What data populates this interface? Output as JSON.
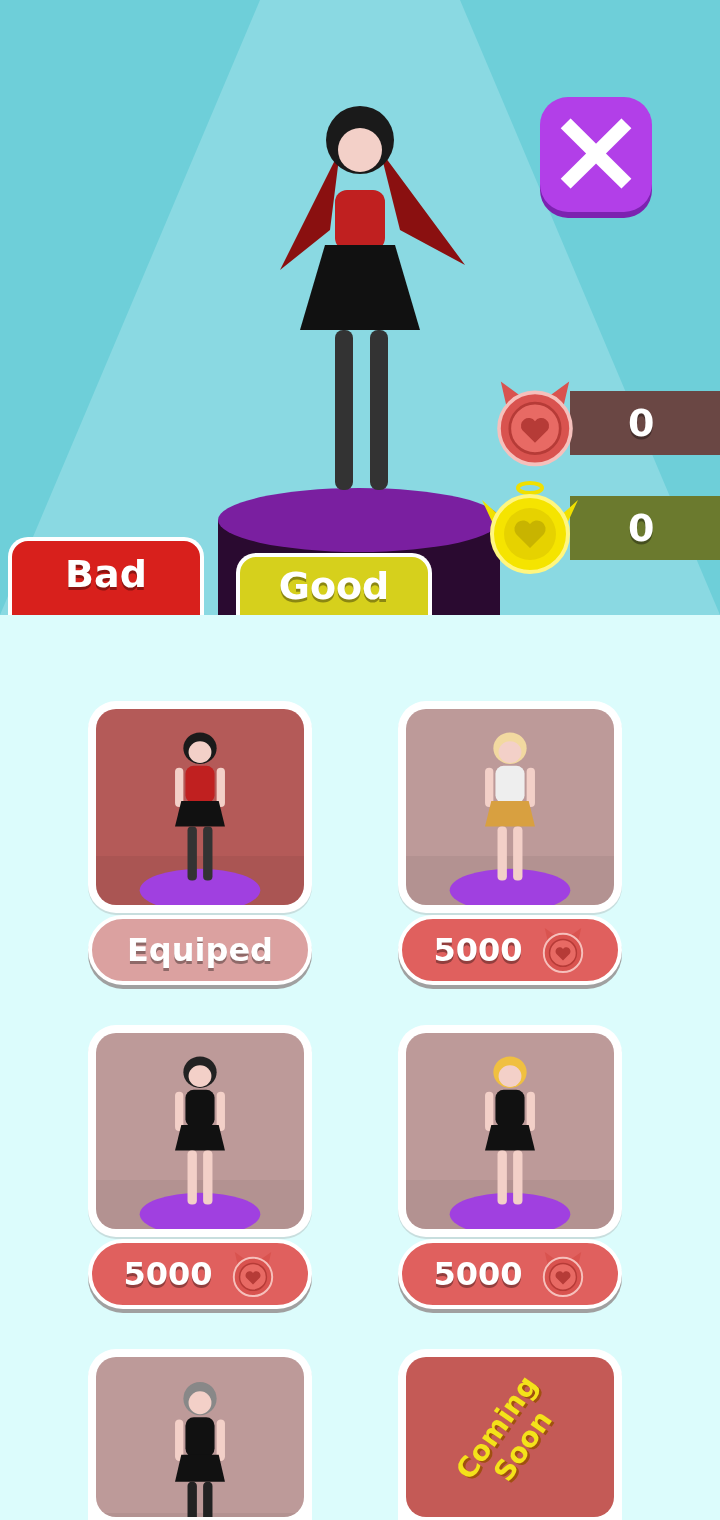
{
  "close_button": {
    "label": "×"
  },
  "currencies": [
    {
      "kind": "bad",
      "amount": "0"
    },
    {
      "kind": "good",
      "amount": "0"
    }
  ],
  "tabs": [
    {
      "label": "Bad",
      "selected": true
    },
    {
      "label": "Good",
      "selected": false
    }
  ],
  "items": [
    {
      "kind": "outfit",
      "selected": true,
      "button": {
        "kind": "equipped",
        "label": "Equiped"
      }
    },
    {
      "kind": "outfit",
      "selected": false,
      "button": {
        "kind": "price",
        "label": "5000"
      }
    },
    {
      "kind": "outfit",
      "selected": false,
      "button": {
        "kind": "price",
        "label": "5000"
      }
    },
    {
      "kind": "outfit",
      "selected": false,
      "button": {
        "kind": "price",
        "label": "5000"
      }
    },
    {
      "kind": "outfit",
      "selected": false
    },
    {
      "kind": "coming_soon",
      "lines": [
        "Coming",
        "Soon"
      ]
    }
  ]
}
